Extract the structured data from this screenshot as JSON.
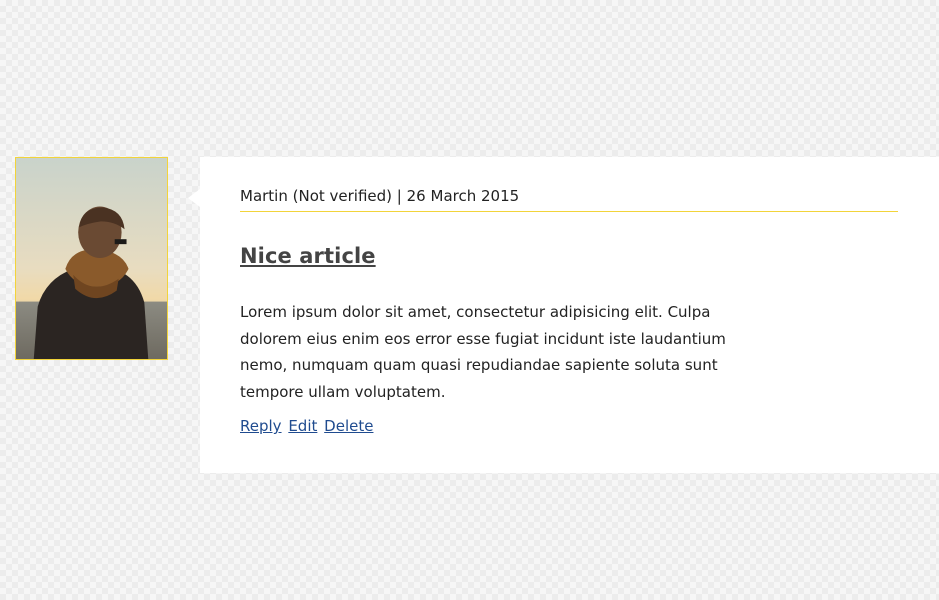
{
  "comment": {
    "author": "Martin (Not verified)",
    "separator": "|",
    "date": "26 March 2015",
    "title": "Nice article",
    "body": "Lorem ipsum dolor sit amet, consectetur adipisicing elit. Culpa dolorem eius enim eos error esse fugiat incidunt iste laudantium nemo, numquam quam quasi repudiandae sapiente soluta sunt tempore ullam voluptatem.",
    "actions": {
      "reply": "Reply",
      "edit": "Edit",
      "delete": "Delete"
    }
  },
  "colors": {
    "accent": "#f2d43a",
    "link": "#1f4b8f",
    "title": "#444444",
    "text": "#222222"
  }
}
